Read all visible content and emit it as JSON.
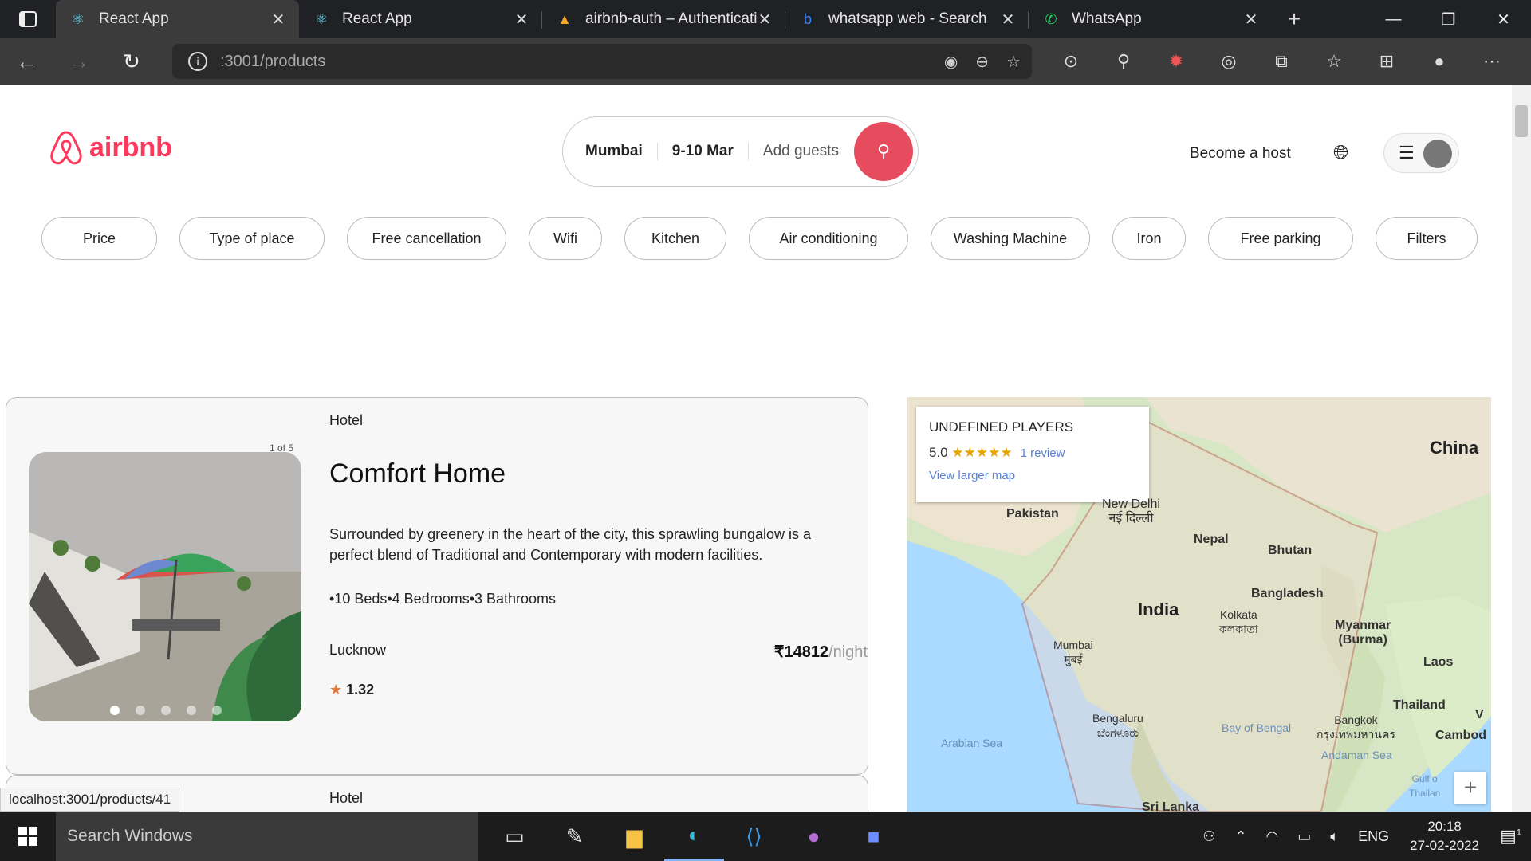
{
  "browser": {
    "tabs": [
      {
        "title": "React App",
        "icon": "react-icon",
        "active": true
      },
      {
        "title": "React App",
        "icon": "react-icon",
        "active": false
      },
      {
        "title": "airbnb-auth – Authenticati",
        "icon": "firebase-icon",
        "active": false
      },
      {
        "title": "whatsapp web - Search",
        "icon": "bing-icon",
        "active": false
      },
      {
        "title": "WhatsApp",
        "icon": "whatsapp-icon",
        "active": false
      }
    ],
    "url_host": "localhost",
    "url_path": ":3001/products",
    "status_url": "localhost:3001/products/41"
  },
  "header": {
    "logo_text": "airbnb",
    "search": {
      "location": "Mumbai",
      "dates": "9-10 Mar",
      "guests_placeholder": "Add guests"
    },
    "become_host": "Become a host"
  },
  "filters": [
    "Price",
    "Type of place",
    "Free cancellation",
    "Wifi",
    "Kitchen",
    "Air conditioning",
    "Washing Machine",
    "Iron",
    "Free parking",
    "Filters"
  ],
  "listings": [
    {
      "type": "Hotel",
      "photo_counter": "1 of 5",
      "title": "Comfort Home",
      "description": "Surrounded by greenery in the heart of the city, this sprawling bungalow is a perfect blend of Traditional and Contemporary with modern facilities.",
      "info": "•10 Beds•4 Bedrooms•3 Bathrooms",
      "city": "Lucknow",
      "price": "₹14812",
      "price_unit": "/night",
      "rating": "1.32"
    },
    {
      "type": "Hotel"
    }
  ],
  "map": {
    "place_name": "UNDEFINED PLAYERS",
    "rating": "5.0",
    "stars": "★★★★★",
    "reviews": "1 review",
    "view_larger": "View larger map",
    "labels": {
      "china": "China",
      "pakistan": "Pakistan",
      "new_delhi": "New Delhi",
      "new_delhi_hi": "नई दिल्ली",
      "nepal": "Nepal",
      "bhutan": "Bhutan",
      "bangladesh": "Bangladesh",
      "india": "India",
      "kolkata": "Kolkata",
      "kolkata_bn": "কলকাতা",
      "myanmar": "Myanmar",
      "burma": "(Burma)",
      "mumbai": "Mumbai",
      "mumbai_mr": "मुंबई",
      "laos": "Laos",
      "thailand": "Thailand",
      "bengaluru": "Bengaluru",
      "bengaluru_kn": "ಬೆಂಗಳೂರು",
      "bay": "Bay of Bengal",
      "bangkok": "Bangkok",
      "bangkok_th": "กรุงเทพมหานคร",
      "arabian": "Arabian Sea",
      "andaman": "Andaman Sea",
      "cambod": "Cambod",
      "gulf": "Gulf o",
      "thailan": "Thailan",
      "srilanka": "Sri Lanka",
      "v": "V"
    }
  },
  "taskbar": {
    "search_placeholder": "Search Windows",
    "lang": "ENG",
    "time": "20:18",
    "date": "27-02-2022",
    "notif": "1"
  }
}
